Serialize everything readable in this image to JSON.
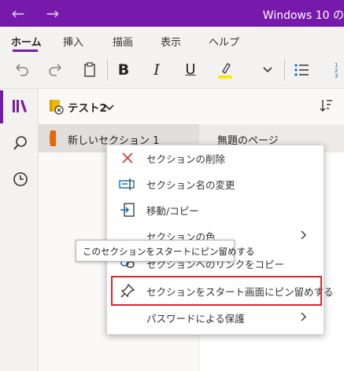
{
  "window": {
    "title": "Windows 10 の"
  },
  "ribbon": {
    "tabs": [
      {
        "label": "ホーム"
      },
      {
        "label": "挿入"
      },
      {
        "label": "描画"
      },
      {
        "label": "表示"
      },
      {
        "label": "ヘルプ"
      }
    ],
    "toolbar": {
      "bold": "B",
      "italic": "I",
      "underline": "U",
      "highlight_color": "#ffe600"
    }
  },
  "notebook": {
    "name": "テスト2"
  },
  "section": {
    "name": "新しいセクション 1",
    "color": "#e8650a"
  },
  "page": {
    "title": "無題のページ"
  },
  "context_menu": {
    "items": [
      {
        "label": "セクションの削除"
      },
      {
        "label": "セクション名の変更"
      },
      {
        "label": "移動/コピー"
      },
      {
        "label": "セクションの色"
      },
      {
        "label": "セクションへのリンクをコピー"
      },
      {
        "label": "セクションをスタート画面にピン留めする"
      },
      {
        "label": "パスワードによる保護"
      }
    ]
  },
  "tooltip": {
    "text": "このセクションをスタートにピン留めする"
  },
  "colors": {
    "accent": "#7719aa",
    "highlight_border": "#e0242a"
  }
}
